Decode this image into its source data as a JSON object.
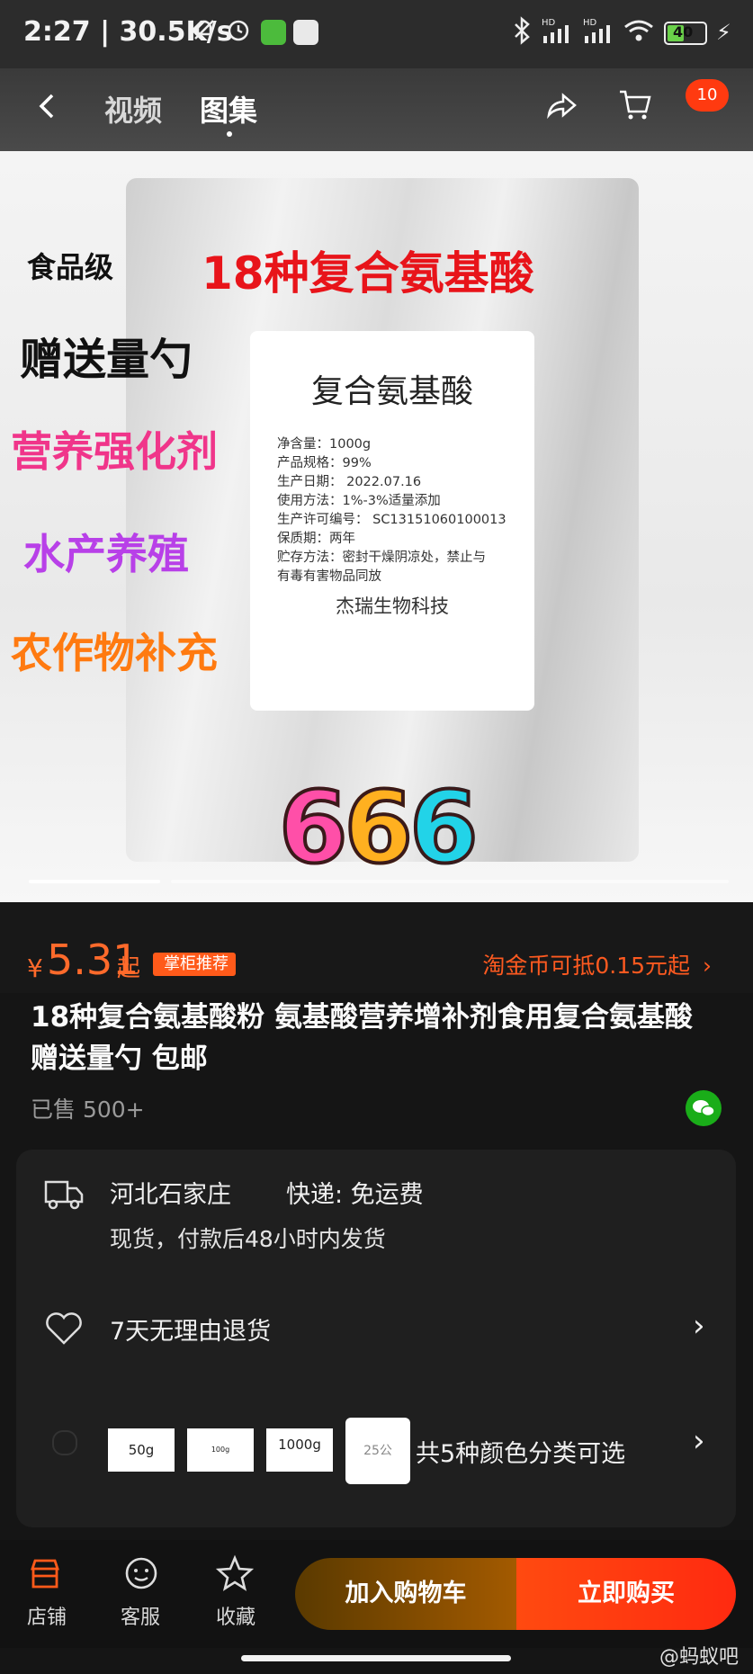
{
  "status_bar": {
    "time": "2:27 | 30.5K/s",
    "signal_labels": [
      "HD",
      "HD"
    ],
    "battery": "40"
  },
  "nav": {
    "tab_video": "视频",
    "tab_gallery": "图集",
    "cart_count": "10"
  },
  "gallery": {
    "promo_lines": [
      "食品级",
      "赠送量勺",
      "营养强化剂",
      "水产养殖",
      "农作物补充"
    ],
    "headline": "18种复合氨基酸",
    "label": {
      "title": "复合氨基酸",
      "lines": [
        "净含量：1000g",
        "产品规格：99%",
        "生产日期： 2022.07.16",
        "使用方法：1%-3%适量添加",
        "生产许可编号： SC13151060100013",
        "保质期：两年",
        "贮存方法：密封干燥阴凉处，禁止与",
        "有毒有害物品同放"
      ],
      "company": "杰瑞生物科技"
    },
    "sticker": "666"
  },
  "price": {
    "currency": "¥",
    "value": "5.31",
    "suffix": "起",
    "badge": "掌柜推荐",
    "coin_offer": "淘金币可抵0.15元起"
  },
  "product": {
    "title": "18种复合氨基酸粉 氨基酸营养增补剂食用复合氨基酸赠送量勺 包邮",
    "sold": "已售 500+"
  },
  "shipping": {
    "location": "河北石家庄",
    "express": "快递: 免运费",
    "dispatch": "现货，付款后48小时内发货"
  },
  "returns": {
    "text": "7天无理由退货"
  },
  "variants": {
    "thumbs": [
      "50g",
      "100g",
      "1000g",
      "25公"
    ],
    "summary": "共5种颜色分类可选"
  },
  "bottom_bar": {
    "shop": "店铺",
    "service": "客服",
    "favorite": "收藏",
    "add_to_cart": "加入购物车",
    "buy_now": "立即购买"
  },
  "watermark": "@蚂蚁吧",
  "colors": {
    "accent_orange": "#ff5a1a",
    "background": "#151515",
    "wechat_green": "#1aad19"
  }
}
